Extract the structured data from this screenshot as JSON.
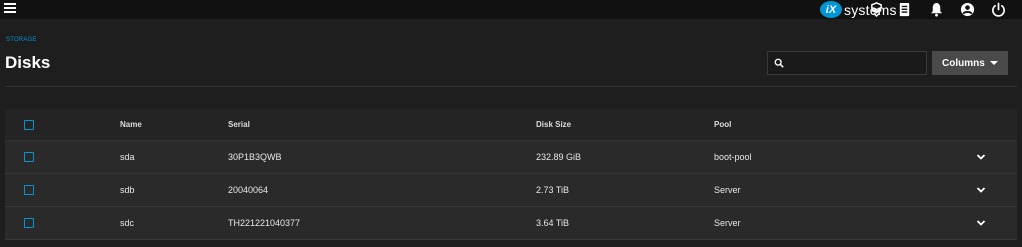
{
  "topbar": {
    "brand_mark": "iX",
    "brand_text": "systems",
    "icons": [
      "menu-icon",
      "truecommand-icon",
      "task-manager-icon",
      "notifications-icon",
      "account-icon",
      "power-icon"
    ]
  },
  "header": {
    "breadcrumb": "STORAGE",
    "title": "Disks"
  },
  "toolbar": {
    "search_placeholder": "",
    "search_value": "",
    "columns_label": "Columns"
  },
  "table": {
    "columns": [
      "Name",
      "Serial",
      "Disk Size",
      "Pool"
    ],
    "rows": [
      {
        "name": "sda",
        "serial": "30P1B3QWB",
        "size": "232.89 GiB",
        "pool": "boot-pool"
      },
      {
        "name": "sdb",
        "serial": "20040064",
        "size": "2.73 TiB",
        "pool": "Server"
      },
      {
        "name": "sdc",
        "serial": "TH221221040377",
        "size": "3.64 TiB",
        "pool": "Server"
      }
    ]
  },
  "colors": {
    "accent": "#0095d5",
    "topbar_bg": "#111111",
    "page_bg": "#1e1e1e",
    "row_bg": "#2a2a2a"
  }
}
